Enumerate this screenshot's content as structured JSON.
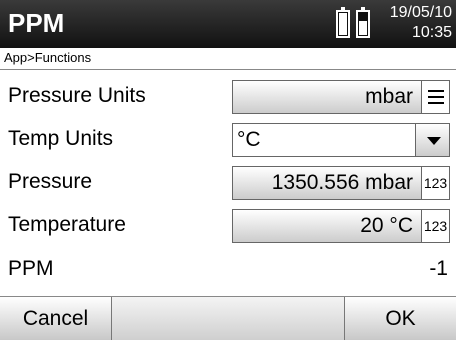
{
  "window": {
    "title": "PPM",
    "date": "19/05/10",
    "time": "10:35",
    "battery_icons": [
      "battery-icon",
      "battery-icon"
    ]
  },
  "breadcrumb": "App>Functions",
  "rows": {
    "pressure_units": {
      "label": "Pressure Units",
      "value": "mbar",
      "button_icon": "menu-icon"
    },
    "temp_units": {
      "label": "Temp Units",
      "value": "°C",
      "button_icon": "chevron-down-icon"
    },
    "pressure": {
      "label": "Pressure",
      "value": "1350.556 mbar",
      "button_label": "123"
    },
    "temperature": {
      "label": "Temperature",
      "value": "20 °C",
      "button_label": "123"
    },
    "ppm": {
      "label": "PPM",
      "value": "-1"
    }
  },
  "footer": {
    "cancel_label": "Cancel",
    "ok_label": "OK"
  }
}
